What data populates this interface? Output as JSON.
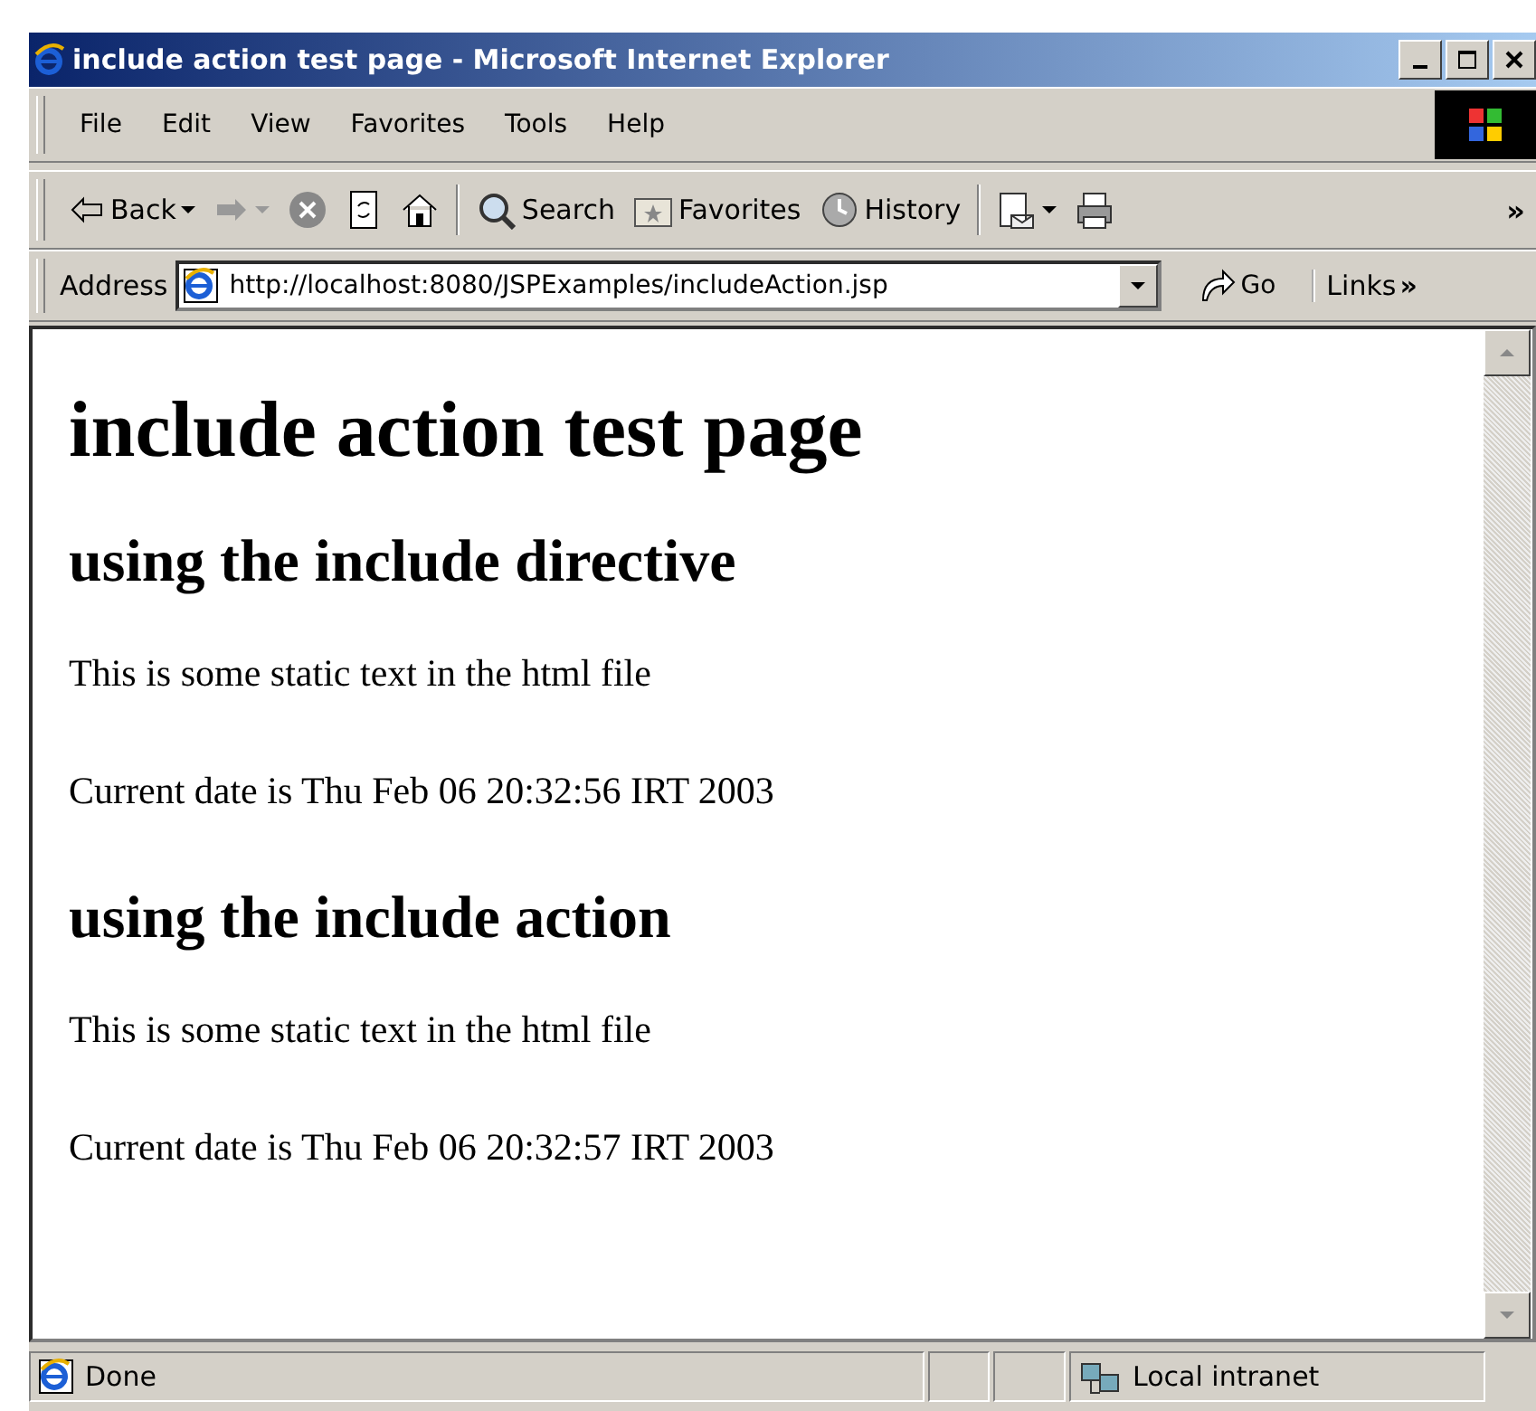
{
  "window": {
    "title": "include action test page - Microsoft Internet Explorer"
  },
  "menu": [
    "File",
    "Edit",
    "View",
    "Favorites",
    "Tools",
    "Help"
  ],
  "toolbar": [
    {
      "kind": "back",
      "label": "Back",
      "dropdown": true
    },
    {
      "kind": "forward",
      "dropdown": true,
      "disabled": true
    },
    {
      "kind": "stop"
    },
    {
      "kind": "refresh"
    },
    {
      "kind": "home",
      "separator_after": true
    },
    {
      "kind": "search",
      "label": "Search"
    },
    {
      "kind": "favorites",
      "label": "Favorites"
    },
    {
      "kind": "history",
      "label": "History",
      "separator_after": true
    },
    {
      "kind": "mail",
      "dropdown": true
    },
    {
      "kind": "print"
    }
  ],
  "toolbar_more": "»",
  "address": {
    "label": "Address",
    "url": "http://localhost:8080/JSPExamples/includeAction.jsp",
    "go": "Go",
    "links": "Links",
    "links_more": "»"
  },
  "content": [
    {
      "kind": "h1",
      "text": "include action test page"
    },
    {
      "kind": "h2",
      "text": "using the include directive"
    },
    {
      "kind": "p",
      "text": "This is some static text in the html file"
    },
    {
      "kind": "p",
      "text": "Current date is Thu Feb 06 20:32:56 IRT 2003"
    },
    {
      "kind": "h2",
      "text": "using the include action"
    },
    {
      "kind": "p",
      "text": "This is some static text in the html file"
    },
    {
      "kind": "p",
      "text": "Current date is Thu Feb 06 20:32:57 IRT 2003"
    }
  ],
  "status_bar": {
    "text": "Done",
    "zone": "Local intranet"
  }
}
